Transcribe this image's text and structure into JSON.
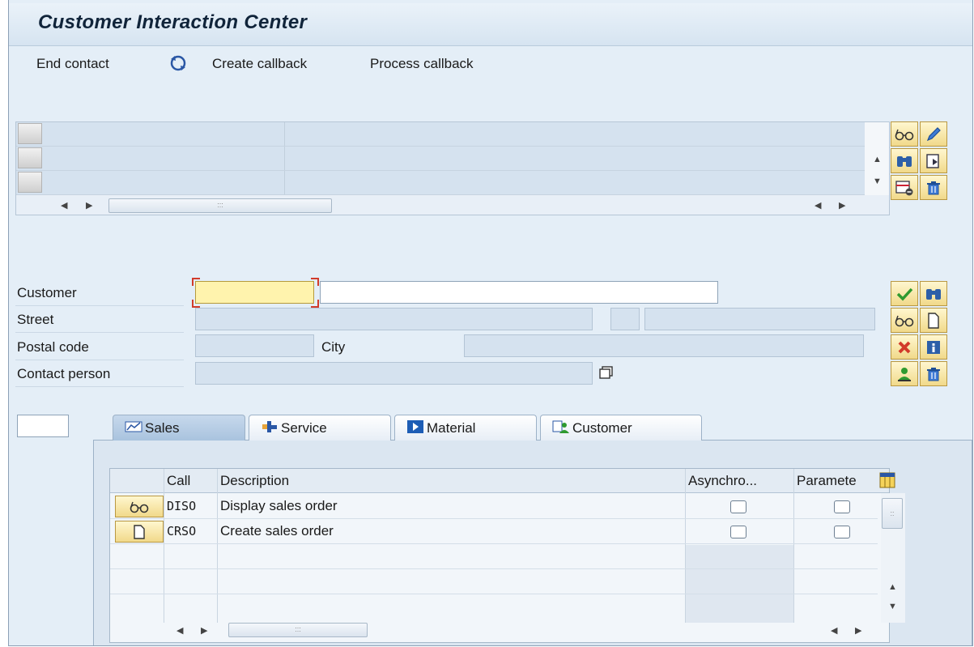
{
  "window": {
    "title": "Customer Interaction Center"
  },
  "toolbar": {
    "end_contact": "End contact",
    "create_callback": "Create callback",
    "process_callback": "Process callback"
  },
  "form": {
    "customer_label": "Customer",
    "street_label": "Street",
    "postal_code_label": "Postal code",
    "city_label": "City",
    "contact_person_label": "Contact person",
    "customer_value": "",
    "customer_name_value": ""
  },
  "tabs": [
    {
      "label": "Sales",
      "icon": "sales-icon",
      "active": true
    },
    {
      "label": "Service",
      "icon": "service-icon",
      "active": false
    },
    {
      "label": "Material",
      "icon": "material-icon",
      "active": false
    },
    {
      "label": "Customer",
      "icon": "customer-icon",
      "active": false
    }
  ],
  "actions_table": {
    "columns": [
      "Call",
      "Description",
      "Asynchro...",
      "Paramete"
    ],
    "rows": [
      {
        "icon": "glasses-icon",
        "call": "DISO",
        "description": "Display sales order",
        "async": false,
        "param": false
      },
      {
        "icon": "new-document-icon",
        "call": "CRSO",
        "description": "Create sales order",
        "async": false,
        "param": false
      }
    ]
  },
  "colors": {
    "background": "#e4eef7",
    "button_yellow": "#f1d98a",
    "focus_field": "#fff3ad",
    "confirm_green": "#2f9a2f",
    "cancel_red": "#d23a2a"
  }
}
